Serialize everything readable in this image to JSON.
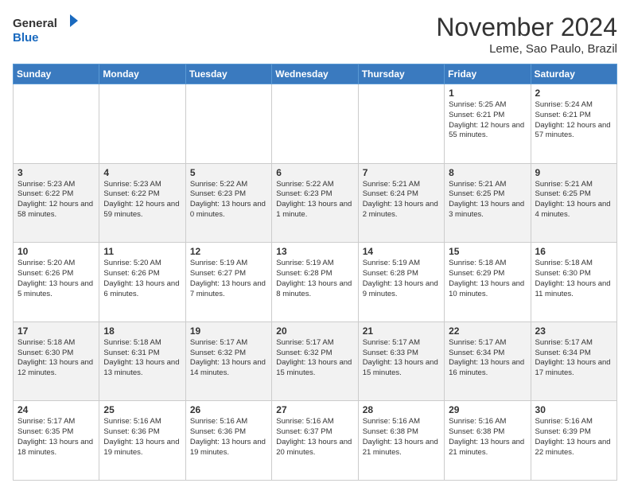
{
  "header": {
    "logo": {
      "line1": "General",
      "line2": "Blue"
    },
    "title": "November 2024",
    "location": "Leme, Sao Paulo, Brazil"
  },
  "weekdays": [
    "Sunday",
    "Monday",
    "Tuesday",
    "Wednesday",
    "Thursday",
    "Friday",
    "Saturday"
  ],
  "weeks": [
    [
      {
        "day": "",
        "info": ""
      },
      {
        "day": "",
        "info": ""
      },
      {
        "day": "",
        "info": ""
      },
      {
        "day": "",
        "info": ""
      },
      {
        "day": "",
        "info": ""
      },
      {
        "day": "1",
        "info": "Sunrise: 5:25 AM\nSunset: 6:21 PM\nDaylight: 12 hours\nand 55 minutes."
      },
      {
        "day": "2",
        "info": "Sunrise: 5:24 AM\nSunset: 6:21 PM\nDaylight: 12 hours\nand 57 minutes."
      }
    ],
    [
      {
        "day": "3",
        "info": "Sunrise: 5:23 AM\nSunset: 6:22 PM\nDaylight: 12 hours\nand 58 minutes."
      },
      {
        "day": "4",
        "info": "Sunrise: 5:23 AM\nSunset: 6:22 PM\nDaylight: 12 hours\nand 59 minutes."
      },
      {
        "day": "5",
        "info": "Sunrise: 5:22 AM\nSunset: 6:23 PM\nDaylight: 13 hours\nand 0 minutes."
      },
      {
        "day": "6",
        "info": "Sunrise: 5:22 AM\nSunset: 6:23 PM\nDaylight: 13 hours\nand 1 minute."
      },
      {
        "day": "7",
        "info": "Sunrise: 5:21 AM\nSunset: 6:24 PM\nDaylight: 13 hours\nand 2 minutes."
      },
      {
        "day": "8",
        "info": "Sunrise: 5:21 AM\nSunset: 6:25 PM\nDaylight: 13 hours\nand 3 minutes."
      },
      {
        "day": "9",
        "info": "Sunrise: 5:21 AM\nSunset: 6:25 PM\nDaylight: 13 hours\nand 4 minutes."
      }
    ],
    [
      {
        "day": "10",
        "info": "Sunrise: 5:20 AM\nSunset: 6:26 PM\nDaylight: 13 hours\nand 5 minutes."
      },
      {
        "day": "11",
        "info": "Sunrise: 5:20 AM\nSunset: 6:26 PM\nDaylight: 13 hours\nand 6 minutes."
      },
      {
        "day": "12",
        "info": "Sunrise: 5:19 AM\nSunset: 6:27 PM\nDaylight: 13 hours\nand 7 minutes."
      },
      {
        "day": "13",
        "info": "Sunrise: 5:19 AM\nSunset: 6:28 PM\nDaylight: 13 hours\nand 8 minutes."
      },
      {
        "day": "14",
        "info": "Sunrise: 5:19 AM\nSunset: 6:28 PM\nDaylight: 13 hours\nand 9 minutes."
      },
      {
        "day": "15",
        "info": "Sunrise: 5:18 AM\nSunset: 6:29 PM\nDaylight: 13 hours\nand 10 minutes."
      },
      {
        "day": "16",
        "info": "Sunrise: 5:18 AM\nSunset: 6:30 PM\nDaylight: 13 hours\nand 11 minutes."
      }
    ],
    [
      {
        "day": "17",
        "info": "Sunrise: 5:18 AM\nSunset: 6:30 PM\nDaylight: 13 hours\nand 12 minutes."
      },
      {
        "day": "18",
        "info": "Sunrise: 5:18 AM\nSunset: 6:31 PM\nDaylight: 13 hours\nand 13 minutes."
      },
      {
        "day": "19",
        "info": "Sunrise: 5:17 AM\nSunset: 6:32 PM\nDaylight: 13 hours\nand 14 minutes."
      },
      {
        "day": "20",
        "info": "Sunrise: 5:17 AM\nSunset: 6:32 PM\nDaylight: 13 hours\nand 15 minutes."
      },
      {
        "day": "21",
        "info": "Sunrise: 5:17 AM\nSunset: 6:33 PM\nDaylight: 13 hours\nand 15 minutes."
      },
      {
        "day": "22",
        "info": "Sunrise: 5:17 AM\nSunset: 6:34 PM\nDaylight: 13 hours\nand 16 minutes."
      },
      {
        "day": "23",
        "info": "Sunrise: 5:17 AM\nSunset: 6:34 PM\nDaylight: 13 hours\nand 17 minutes."
      }
    ],
    [
      {
        "day": "24",
        "info": "Sunrise: 5:17 AM\nSunset: 6:35 PM\nDaylight: 13 hours\nand 18 minutes."
      },
      {
        "day": "25",
        "info": "Sunrise: 5:16 AM\nSunset: 6:36 PM\nDaylight: 13 hours\nand 19 minutes."
      },
      {
        "day": "26",
        "info": "Sunrise: 5:16 AM\nSunset: 6:36 PM\nDaylight: 13 hours\nand 19 minutes."
      },
      {
        "day": "27",
        "info": "Sunrise: 5:16 AM\nSunset: 6:37 PM\nDaylight: 13 hours\nand 20 minutes."
      },
      {
        "day": "28",
        "info": "Sunrise: 5:16 AM\nSunset: 6:38 PM\nDaylight: 13 hours\nand 21 minutes."
      },
      {
        "day": "29",
        "info": "Sunrise: 5:16 AM\nSunset: 6:38 PM\nDaylight: 13 hours\nand 21 minutes."
      },
      {
        "day": "30",
        "info": "Sunrise: 5:16 AM\nSunset: 6:39 PM\nDaylight: 13 hours\nand 22 minutes."
      }
    ]
  ]
}
